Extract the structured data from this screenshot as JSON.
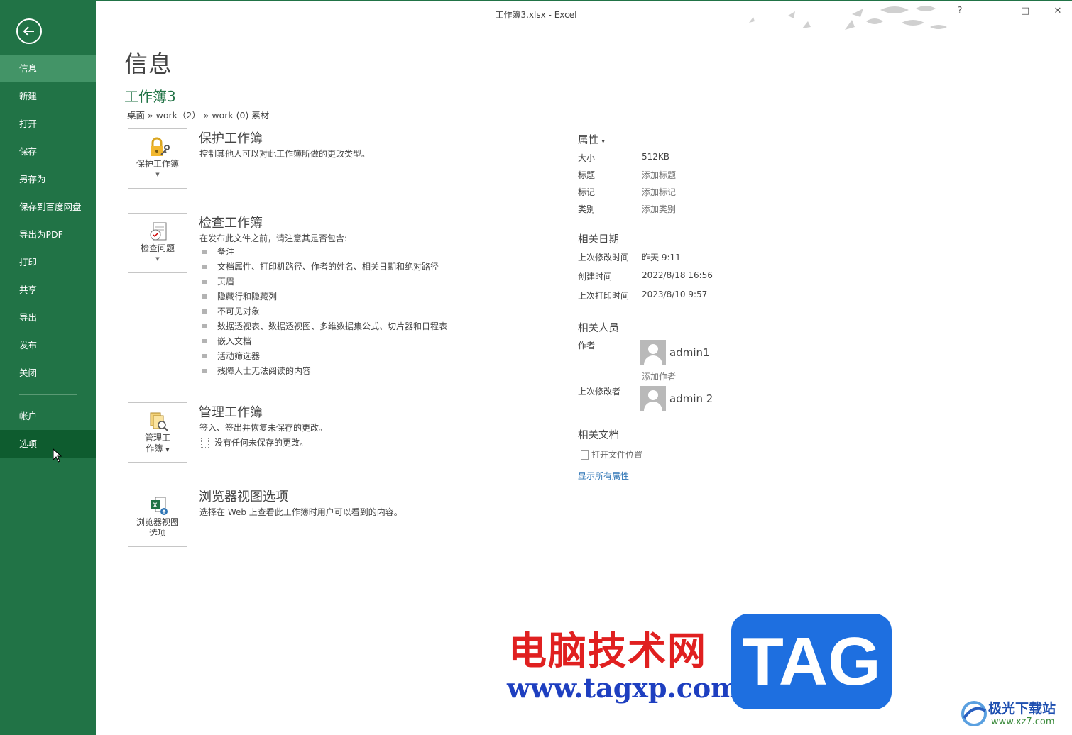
{
  "window": {
    "title": "工作簿3.xlsx - Excel",
    "help": "?",
    "minimize": "–",
    "maximize": "□",
    "close": "✕"
  },
  "sidebar": {
    "items": [
      {
        "label": "信息"
      },
      {
        "label": "新建"
      },
      {
        "label": "打开"
      },
      {
        "label": "保存"
      },
      {
        "label": "另存为"
      },
      {
        "label": "保存到百度网盘"
      },
      {
        "label": "导出为PDF"
      },
      {
        "label": "打印"
      },
      {
        "label": "共享"
      },
      {
        "label": "导出"
      },
      {
        "label": "发布"
      },
      {
        "label": "关闭"
      }
    ],
    "account": "帐户",
    "options": "选项"
  },
  "main": {
    "title": "信息",
    "workbook": "工作簿3",
    "breadcrumb": "桌面 » work（2） » work (0) 素材",
    "protect": {
      "button": "保护工作簿",
      "heading": "保护工作簿",
      "desc": "控制其他人可以对此工作簿所做的更改类型。"
    },
    "inspect": {
      "button": "检查问题",
      "heading": "检查工作簿",
      "desc": "在发布此文件之前，请注意其是否包含:",
      "bullets": [
        "备注",
        "文档属性、打印机路径、作者的姓名、相关日期和绝对路径",
        "页眉",
        "隐藏行和隐藏列",
        "不可见对象",
        "数据透视表、数据透视图、多维数据集公式、切片器和日程表",
        "嵌入文档",
        "活动筛选器",
        "残障人士无法阅读的内容"
      ]
    },
    "manage": {
      "button_line1": "管理工",
      "button_line2": "作簿",
      "heading": "管理工作簿",
      "desc": "签入、签出并恢复未保存的更改。",
      "status": "没有任何未保存的更改。"
    },
    "browser": {
      "button_line1": "浏览器视图",
      "button_line2": "选项",
      "heading": "浏览器视图选项",
      "desc": "选择在 Web 上查看此工作簿时用户可以看到的内容。"
    }
  },
  "properties": {
    "heading": "属性",
    "caret": "▾",
    "rows": [
      {
        "label": "大小",
        "value": "512KB"
      },
      {
        "label": "标题",
        "value": "添加标题"
      },
      {
        "label": "标记",
        "value": "添加标记"
      },
      {
        "label": "类别",
        "value": "添加类别"
      }
    ],
    "dates_heading": "相关日期",
    "dates": [
      {
        "label": "上次修改时间",
        "value": "昨天 9:11"
      },
      {
        "label": "创建时间",
        "value": "2022/8/18 16:56"
      },
      {
        "label": "上次打印时间",
        "value": "2023/8/10 9:57"
      }
    ],
    "people_heading": "相关人员",
    "author_label": "作者",
    "author_name": "admin1",
    "add_author": "添加作者",
    "modifier_label": "上次修改者",
    "modifier_name": "admin 2",
    "docs_heading": "相关文档",
    "open_location": "打开文件位置",
    "show_all": "显示所有属性"
  },
  "watermark": {
    "cn": "电脑技术网",
    "url": "www.tagxp.com",
    "tag": "TAG",
    "site2_cn": "极光下载站",
    "site2_url": "www.xz7.com"
  }
}
